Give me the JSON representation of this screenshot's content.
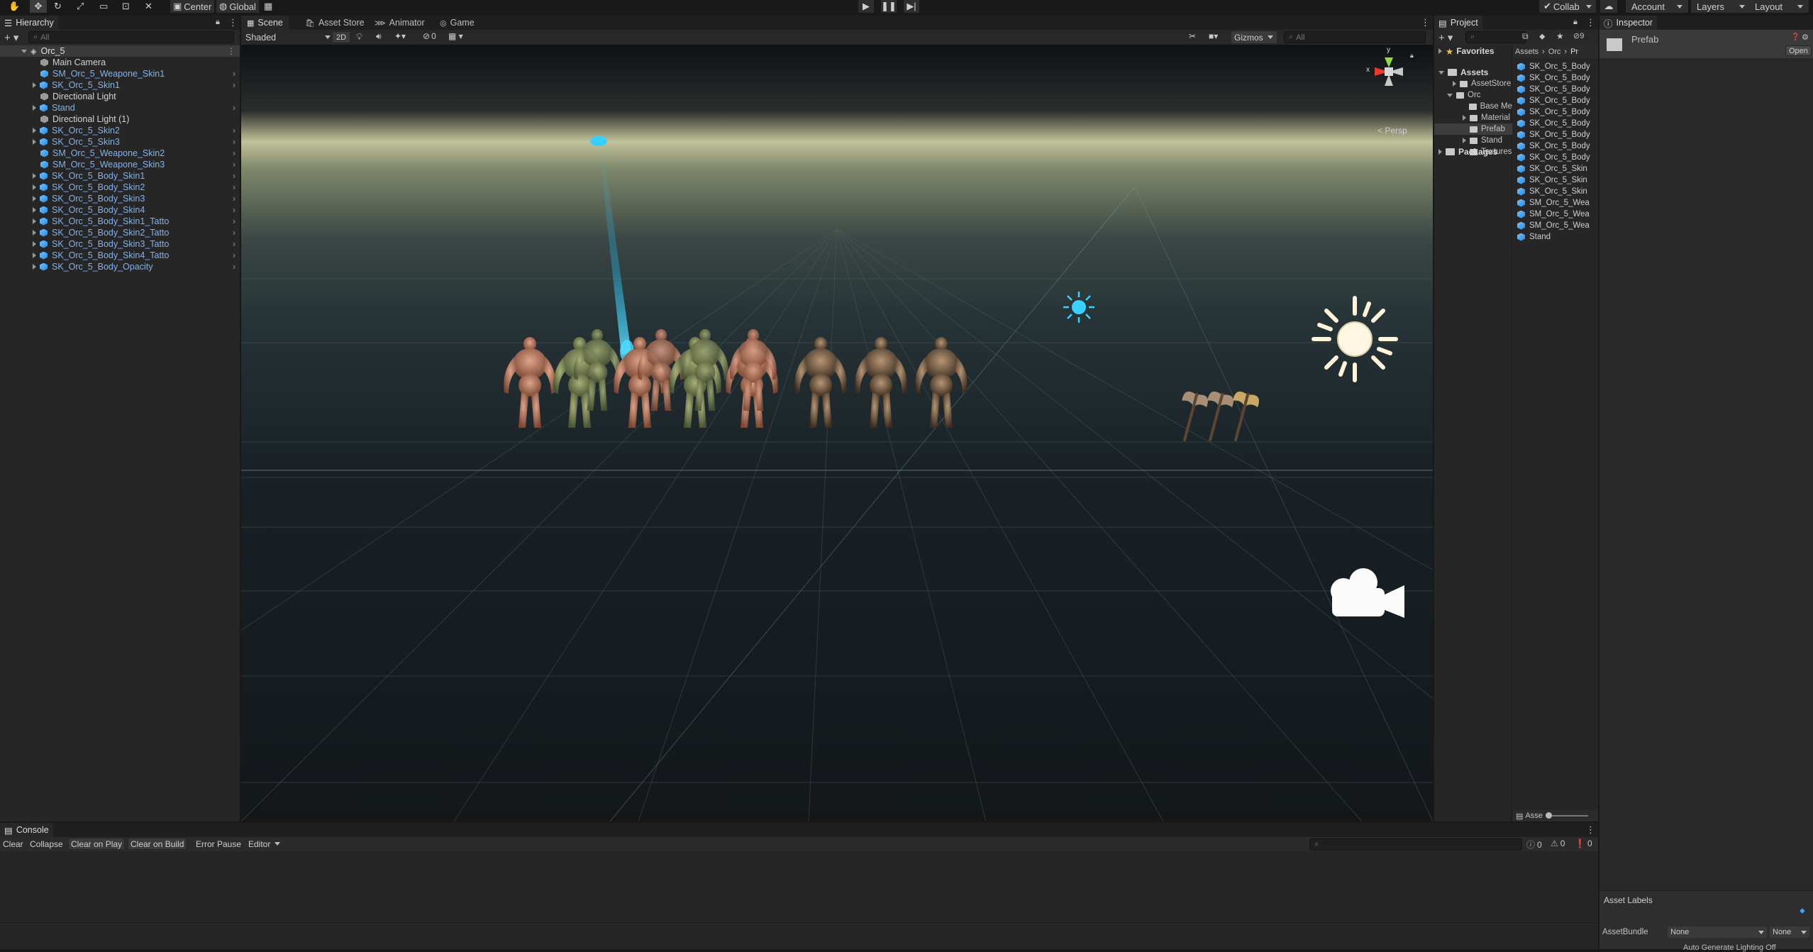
{
  "toolbar": {
    "pivot_label": "Center",
    "space_label": "Global",
    "collab_label": "Collab",
    "account_label": "Account",
    "layers_label": "Layers",
    "layout_label": "Layout"
  },
  "hierarchy": {
    "tab": "Hierarchy",
    "search_placeholder": "All",
    "scene_name": "Orc_5",
    "items": [
      {
        "label": "Main Camera",
        "blue": false,
        "expandable": false
      },
      {
        "label": "SM_Orc_5_Weapone_Skin1",
        "blue": true,
        "expandable": false
      },
      {
        "label": "SK_Orc_5_Skin1",
        "blue": true,
        "expandable": true
      },
      {
        "label": "Directional Light",
        "blue": false,
        "expandable": false
      },
      {
        "label": "Stand",
        "blue": true,
        "expandable": true
      },
      {
        "label": "Directional Light (1)",
        "blue": false,
        "expandable": false
      },
      {
        "label": "SK_Orc_5_Skin2",
        "blue": true,
        "expandable": true
      },
      {
        "label": "SK_Orc_5_Skin3",
        "blue": true,
        "expandable": true
      },
      {
        "label": "SM_Orc_5_Weapone_Skin2",
        "blue": true,
        "expandable": false
      },
      {
        "label": "SM_Orc_5_Weapone_Skin3",
        "blue": true,
        "expandable": false
      },
      {
        "label": "SK_Orc_5_Body_Skin1",
        "blue": true,
        "expandable": true
      },
      {
        "label": "SK_Orc_5_Body_Skin2",
        "blue": true,
        "expandable": true
      },
      {
        "label": "SK_Orc_5_Body_Skin3",
        "blue": true,
        "expandable": true
      },
      {
        "label": "SK_Orc_5_Body_Skin4",
        "blue": true,
        "expandable": true
      },
      {
        "label": "SK_Orc_5_Body_Skin1_Tatto",
        "blue": true,
        "expandable": true
      },
      {
        "label": "SK_Orc_5_Body_Skin2_Tatto",
        "blue": true,
        "expandable": true
      },
      {
        "label": "SK_Orc_5_Body_Skin3_Tatto",
        "blue": true,
        "expandable": true
      },
      {
        "label": "SK_Orc_5_Body_Skin4_Tatto",
        "blue": true,
        "expandable": true
      },
      {
        "label": "SK_Orc_5_Body_Opacity",
        "blue": true,
        "expandable": true
      }
    ]
  },
  "center_tabs": [
    "Scene",
    "Asset Store",
    "Animator",
    "Game"
  ],
  "scene_toolbar": {
    "shading": "Shaded",
    "mode_2d": "2D",
    "hidden_count": "0",
    "gizmos": "Gizmos",
    "search_placeholder": "All",
    "persp_label": "< Persp",
    "axis_x": "x",
    "axis_y": "y"
  },
  "project": {
    "tab": "Project",
    "favorites": "Favorites",
    "assets": "Assets",
    "tree": [
      "AssetStore",
      "Orc",
      "Base Me",
      "Material",
      "Prefab",
      "Stand",
      "Textures"
    ],
    "packages": "Packages",
    "breadcrumb": [
      "Assets",
      "Orc",
      "Pr"
    ],
    "hidden_count": "9",
    "files": [
      "SK_Orc_5_Body",
      "SK_Orc_5_Body",
      "SK_Orc_5_Body",
      "SK_Orc_5_Body",
      "SK_Orc_5_Body",
      "SK_Orc_5_Body",
      "SK_Orc_5_Body",
      "SK_Orc_5_Body",
      "SK_Orc_5_Body",
      "SK_Orc_5_Skin",
      "SK_Orc_5_Skin",
      "SK_Orc_5_Skin",
      "SM_Orc_5_Wea",
      "SM_Orc_5_Wea",
      "SM_Orc_5_Wea",
      "Stand"
    ],
    "footer": "Asse"
  },
  "inspector": {
    "tab": "Inspector",
    "title": "Prefab",
    "open_button": "Open",
    "asset_labels": "Asset Labels",
    "assetbundle_label": "AssetBundle",
    "bundle_value": "None",
    "variant_value": "None",
    "footer_text": "Auto Generate Lighting Off"
  },
  "console": {
    "tab": "Console",
    "buttons": [
      "Clear",
      "Collapse",
      "Clear on Play",
      "Clear on Build",
      "Error Pause",
      "Editor"
    ],
    "log_count": "0",
    "warn_count": "0",
    "error_count": "0"
  },
  "colors": {
    "accent": "#4cc2ff",
    "hierarchy_link": "#7fb4f0"
  }
}
